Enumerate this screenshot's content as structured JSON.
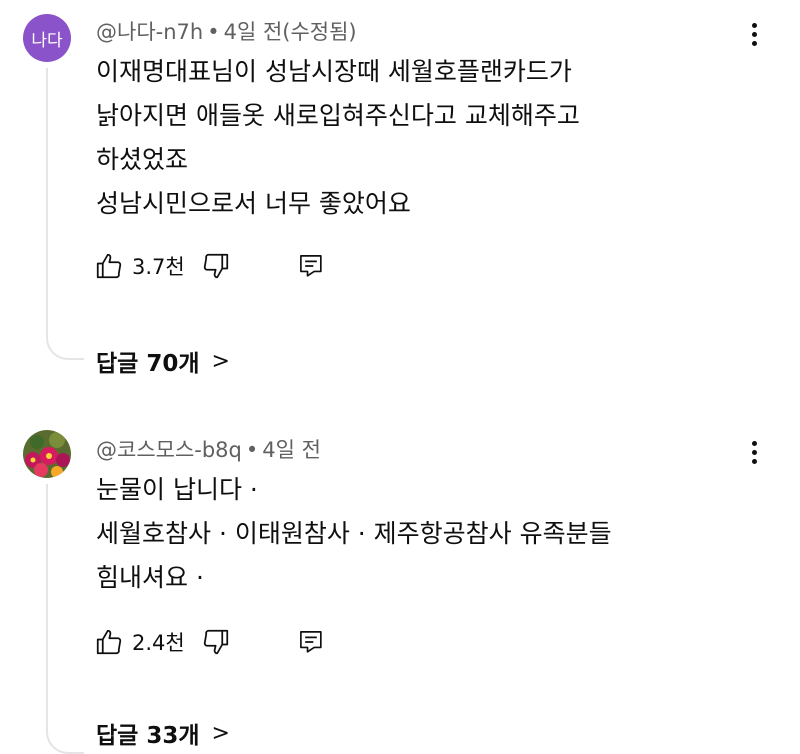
{
  "comments": [
    {
      "avatar_text": "나다",
      "author": "@나다-n7h",
      "time": "4일 전(수정됨)",
      "lines": [
        "이재명대표님이 성남시장때 세월호플랜카드가",
        "낡아지면 애들옷 새로입혀주신다고 교체해주고",
        "하셨었죠",
        "성남시민으로서 너무 좋았어요"
      ],
      "likes": "3.7천",
      "replies_label": "답글 70개"
    },
    {
      "author": "@코스모스-b8q",
      "time": "4일 전",
      "lines": [
        "눈물이 납니다 ·",
        "세월호참사 · 이태원참사 · 제주항공참사 유족분들",
        "힘내셔요 ·"
      ],
      "likes": "2.4천",
      "replies_label": "답글 33개"
    }
  ],
  "icons": {
    "like": "thumbs-up-icon",
    "dislike": "thumbs-down-icon",
    "reply": "reply-comment-icon",
    "menu": "more-vertical-icon",
    "chevron": "chevron-right-icon"
  },
  "colors": {
    "avatar_bg": "#8a53c9",
    "text": "#0f0f0f",
    "meta": "#606060",
    "thread_line": "#e5e5e5"
  }
}
